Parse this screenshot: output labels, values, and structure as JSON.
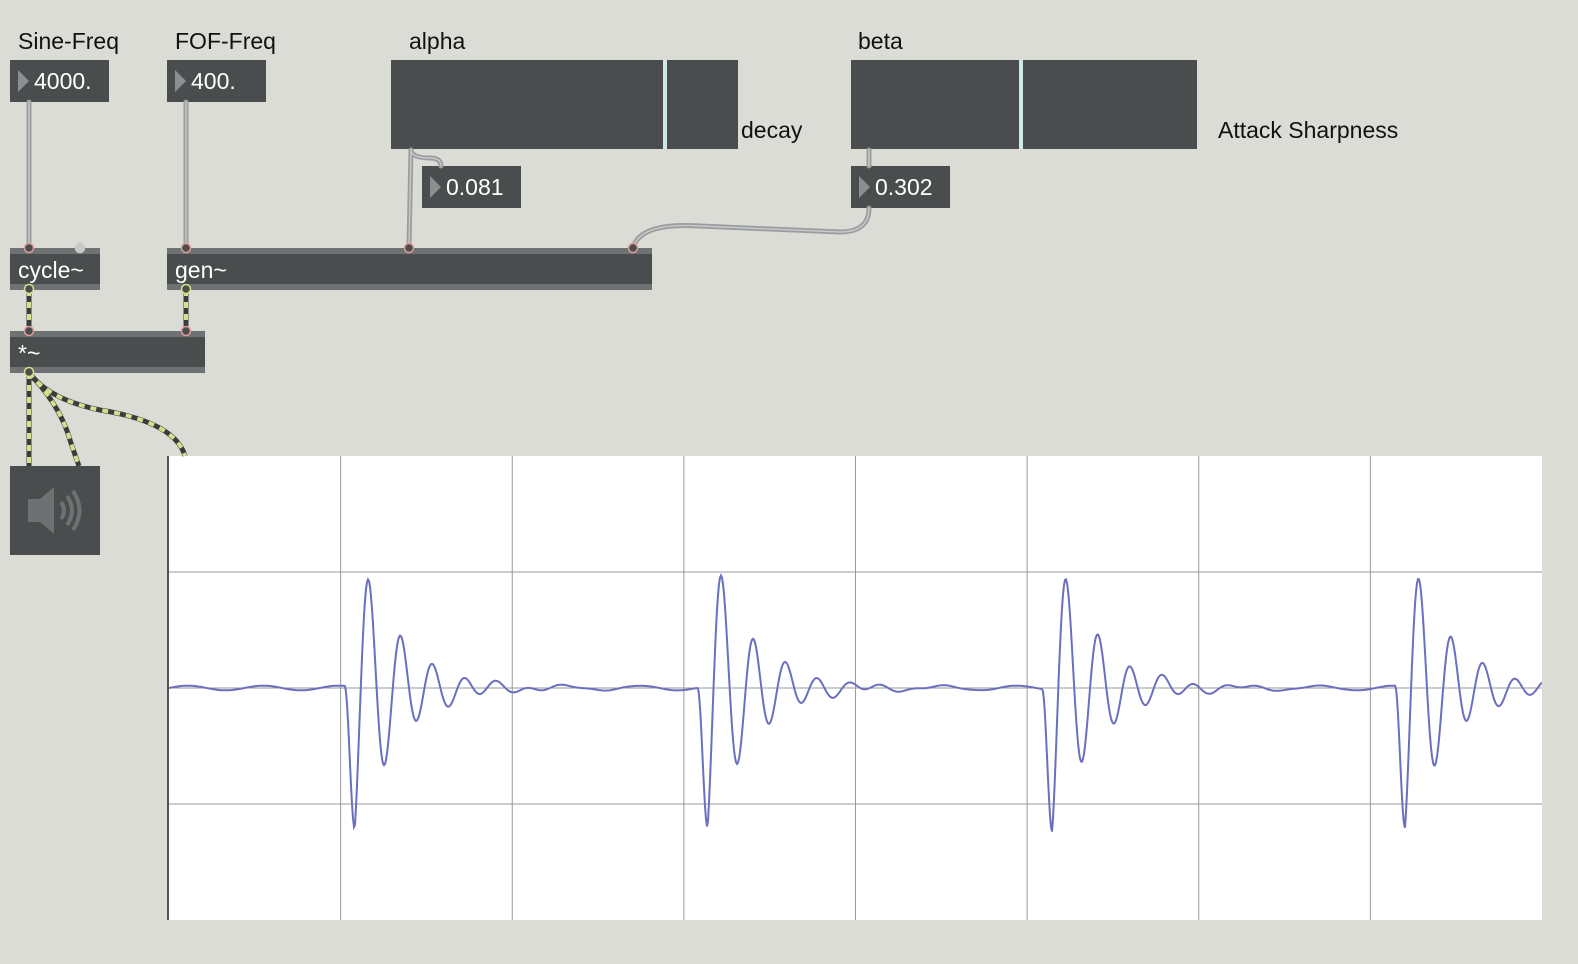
{
  "labels": {
    "sine_freq": "Sine-Freq",
    "fof_freq": "FOF-Freq",
    "alpha": "alpha",
    "beta": "beta",
    "decay": "decay",
    "attack_sharpness": "Attack Sharpness"
  },
  "number_boxes": {
    "sine_freq": "4000.",
    "fof_freq": "400.",
    "alpha": "0.081",
    "beta": "0.302"
  },
  "sliders": {
    "alpha_level": 0.79,
    "beta_level": 0.49
  },
  "objects": {
    "cycle": "cycle~",
    "gen": "gen~",
    "multiply": "*~"
  },
  "icons": {
    "speaker": "speaker-icon"
  },
  "colors": {
    "patch_bg": "#dcdcd6",
    "box_bg": "#4a4d4d",
    "signal_wire": "#d6e08a",
    "control_wire": "#9a9d9d",
    "waveform": "#6a6fbf",
    "grid": "#9a9a9a"
  },
  "scope": {
    "grid_columns": 8,
    "grid_rows": 4,
    "ylim": [
      -1,
      1
    ],
    "burst_count": 4,
    "burst_start_fractions": [
      0.128,
      0.385,
      0.636,
      0.893
    ]
  }
}
